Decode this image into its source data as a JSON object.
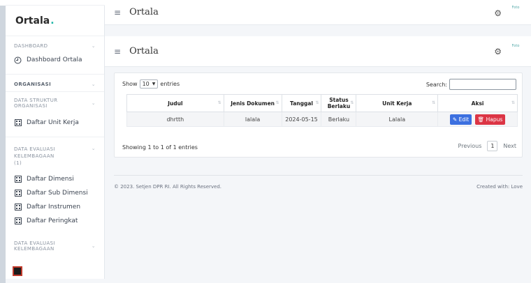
{
  "brand": {
    "name": "Ortala",
    "dot": "."
  },
  "header": {
    "title": "Ortala",
    "avatar_alt": "Foto"
  },
  "sidebar": {
    "sec_dashboard": "DASHBOARD",
    "dashboard_item": "Dashboard Ortala",
    "sec_organisasi": "ORGANISASI",
    "sec_struktur": "DATA STRUKTUR ORGANISASI",
    "unit_kerja": "Daftar Unit Kerja",
    "sec_evaluasi1": "DATA EVALUASI KELEMBAGAAN",
    "sec_evaluasi1_sub": "(1)",
    "items": [
      "Daftar Dimensi",
      "Daftar Sub Dimensi",
      "Daftar Instrumen",
      "Daftar Peringkat"
    ],
    "sec_evaluasi2": "DATA EVALUASI KELEMBAGAAN"
  },
  "table_controls": {
    "show": "Show",
    "entries_value": "10",
    "entries": "entries",
    "search_label": "Search:"
  },
  "table": {
    "headers": [
      "Judul",
      "Jenis Dokumen",
      "Tanggal",
      "Status Berlaku",
      "Unit Kerja",
      "Aksi"
    ],
    "rows": [
      {
        "judul": "dhrtth",
        "jenis": "lalala",
        "tanggal": "2024-05-15",
        "status": "Berlaku",
        "unit": "Lalala"
      }
    ],
    "edit_label": "Edit",
    "delete_label": "Hapus"
  },
  "pagination": {
    "info": "Showing 1 to 1 of 1 entries",
    "previous": "Previous",
    "page": "1",
    "next": "Next"
  },
  "footer": {
    "copyright": "© 2023. Setjen DPR RI. All Rights Reserved.",
    "created": "Created with: Love"
  }
}
